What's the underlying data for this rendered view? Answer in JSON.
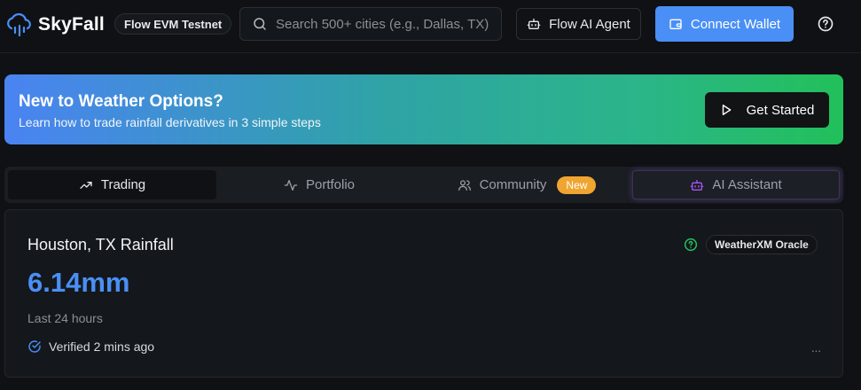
{
  "header": {
    "brand": "SkyFall",
    "network": "Flow EVM Testnet",
    "search_placeholder": "Search 500+ cities (e.g., Dallas, TX)",
    "agent_label": "Flow AI Agent",
    "wallet_label": "Connect Wallet",
    "icons": [
      "cloud-rain-logo-icon",
      "search-icon",
      "robot-icon",
      "wallet-icon",
      "help-circle-icon"
    ]
  },
  "banner": {
    "title": "New to Weather Options?",
    "subtitle": "Learn how to trade rainfall derivatives in 3 simple steps",
    "cta_label": "Get Started",
    "cta_icon": "play-icon"
  },
  "tabs": [
    {
      "label": "Trading",
      "icon": "trending-up-icon",
      "active": true
    },
    {
      "label": "Portfolio",
      "icon": "activity-icon",
      "active": false
    },
    {
      "label": "Community",
      "icon": "users-icon",
      "active": false,
      "badge": "New"
    },
    {
      "label": "AI Assistant",
      "icon": "robot-icon",
      "active": false
    }
  ],
  "card": {
    "title": "Houston, TX Rainfall",
    "oracle": "WeatherXM Oracle",
    "amount": "6.14mm",
    "period": "Last 24 hours",
    "verified": "Verified 2 mins ago",
    "more": "..."
  },
  "colors": {
    "background": "#0f1114",
    "accent": "#4a8ff5",
    "badge_new": "#f0a531",
    "oracle_icon": "#22c55e",
    "ai_icon": "#a855f7"
  }
}
